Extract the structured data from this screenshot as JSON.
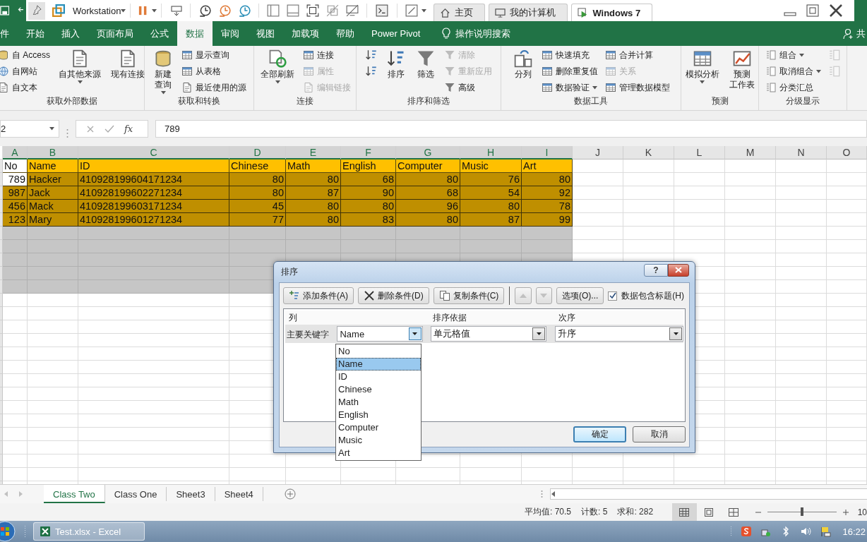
{
  "vm_toolbar": {
    "machine": "Workstation",
    "tabs": [
      {
        "kind": "home",
        "label": "主页",
        "selected": false
      },
      {
        "kind": "computer",
        "label": "我的计算机",
        "selected": false
      },
      {
        "kind": "vm",
        "label": "Windows 7",
        "selected": true
      }
    ]
  },
  "ribbon": {
    "tabs": [
      {
        "label": "件",
        "selected": false
      },
      {
        "label": "开始",
        "selected": false
      },
      {
        "label": "插入",
        "selected": false
      },
      {
        "label": "页面布局",
        "selected": false
      },
      {
        "label": "公式",
        "selected": false
      },
      {
        "label": "数据",
        "selected": true
      },
      {
        "label": "审阅",
        "selected": false
      },
      {
        "label": "视图",
        "selected": false
      },
      {
        "label": "加载项",
        "selected": false
      },
      {
        "label": "帮助",
        "selected": false
      },
      {
        "label": "Power Pivot",
        "selected": false
      }
    ],
    "tell_me": "操作说明搜索",
    "share": "共",
    "groups": [
      {
        "label": "获取外部数据",
        "items": [
          {
            "kind": "stack",
            "items": [
              {
                "kind": "small",
                "label": "自 Access",
                "disabled": false
              },
              {
                "kind": "small",
                "label": "自网站",
                "disabled": false
              },
              {
                "kind": "small",
                "label": "自文本",
                "disabled": false
              }
            ]
          },
          {
            "kind": "large",
            "label": "自其他来源",
            "disabled": false,
            "dropdown": true
          },
          {
            "kind": "large",
            "label": "现有连接",
            "disabled": false
          }
        ]
      },
      {
        "label": "获取和转换",
        "items": [
          {
            "kind": "large",
            "lines": [
              "新建",
              "查询"
            ],
            "disabled": false,
            "dropdown": true
          },
          {
            "kind": "stack",
            "items": [
              {
                "kind": "small",
                "label": "显示查询",
                "disabled": false
              },
              {
                "kind": "small",
                "label": "从表格",
                "disabled": false
              },
              {
                "kind": "small",
                "label": "最近使用的源",
                "disabled": false
              }
            ]
          }
        ]
      },
      {
        "label": "连接",
        "items": [
          {
            "kind": "large",
            "label": "全部刷新",
            "disabled": false,
            "dropdown": true
          },
          {
            "kind": "stack",
            "items": [
              {
                "kind": "small",
                "label": "连接",
                "disabled": false
              },
              {
                "kind": "small",
                "label": "属性",
                "disabled": true
              },
              {
                "kind": "small",
                "label": "编辑链接",
                "disabled": true
              }
            ]
          }
        ]
      },
      {
        "label": "排序和筛选",
        "items": [
          {
            "kind": "stack",
            "items": [
              {
                "kind": "icon",
                "disabled": false
              },
              {
                "kind": "icon",
                "disabled": false
              }
            ]
          },
          {
            "kind": "large",
            "label": "排序",
            "disabled": false
          },
          {
            "kind": "large",
            "label": "筛选",
            "disabled": false
          },
          {
            "kind": "stack",
            "items": [
              {
                "kind": "small",
                "label": "清除",
                "disabled": true
              },
              {
                "kind": "small",
                "label": "重新应用",
                "disabled": true
              },
              {
                "kind": "small",
                "label": "高级",
                "disabled": false
              }
            ]
          }
        ]
      },
      {
        "label": "数据工具",
        "items": [
          {
            "kind": "large",
            "label": "分列",
            "disabled": false
          },
          {
            "kind": "stack",
            "items": [
              {
                "kind": "small",
                "label": "快速填充",
                "disabled": false
              },
              {
                "kind": "small",
                "label": "删除重复值",
                "disabled": false
              },
              {
                "kind": "small",
                "label": "数据验证",
                "disabled": false,
                "dropdown": true
              }
            ]
          },
          {
            "kind": "stack",
            "items": [
              {
                "kind": "small",
                "label": "合并计算",
                "disabled": false
              },
              {
                "kind": "small",
                "label": "关系",
                "disabled": true
              },
              {
                "kind": "small",
                "label": "管理数据模型",
                "disabled": false
              }
            ]
          }
        ]
      },
      {
        "label": "预测",
        "items": [
          {
            "kind": "large",
            "label": "模拟分析",
            "disabled": false,
            "dropdown": true
          },
          {
            "kind": "large",
            "lines": [
              "预测",
              "工作表"
            ],
            "disabled": false
          }
        ]
      },
      {
        "label": "分级显示",
        "items": [
          {
            "kind": "stack",
            "items": [
              {
                "kind": "small",
                "label": "组合",
                "disabled": false,
                "dropdown": true
              },
              {
                "kind": "small",
                "label": "取消组合",
                "disabled": false,
                "dropdown": true
              },
              {
                "kind": "small",
                "label": "分类汇总",
                "disabled": false
              }
            ]
          },
          {
            "kind": "stack",
            "items": [
              {
                "kind": "icon",
                "disabled": true
              },
              {
                "kind": "icon",
                "disabled": true
              }
            ]
          }
        ]
      }
    ]
  },
  "formula_bar": {
    "name_box": "2",
    "function_button": "fx",
    "value": "789"
  },
  "sheet": {
    "columns": [
      {
        "label": "A",
        "selected": true
      },
      {
        "label": "B",
        "selected": true
      },
      {
        "label": "C",
        "selected": true
      },
      {
        "label": "D",
        "selected": true
      },
      {
        "label": "E",
        "selected": true
      },
      {
        "label": "F",
        "selected": true
      },
      {
        "label": "G",
        "selected": true
      },
      {
        "label": "H",
        "selected": true
      },
      {
        "label": "I",
        "selected": true
      },
      {
        "label": "J",
        "selected": false
      },
      {
        "label": "K",
        "selected": false
      },
      {
        "label": "L",
        "selected": false
      },
      {
        "label": "M",
        "selected": false
      },
      {
        "label": "N",
        "selected": false
      },
      {
        "label": "O",
        "selected": false
      }
    ],
    "rows": [
      {
        "kind": "header",
        "active": true,
        "cells": [
          "No",
          "Name",
          "ID",
          "Chinese",
          "Math",
          "English",
          "Computer",
          "Music",
          "Art"
        ]
      },
      {
        "kind": "data",
        "active": true,
        "cells": [
          "789",
          "Hacker",
          "410928199604171234",
          "80",
          "80",
          "68",
          "80",
          "76",
          "80"
        ]
      },
      {
        "kind": "data",
        "active": false,
        "cells": [
          "987",
          "Jack",
          "410928199602271234",
          "80",
          "87",
          "90",
          "68",
          "54",
          "92"
        ]
      },
      {
        "kind": "data",
        "active": false,
        "cells": [
          "456",
          "Mack",
          "410928199603171234",
          "45",
          "80",
          "80",
          "96",
          "80",
          "78"
        ]
      },
      {
        "kind": "data",
        "active": false,
        "cells": [
          "123",
          "Mary",
          "410928199601271234",
          "77",
          "80",
          "83",
          "80",
          "87",
          "99"
        ]
      },
      {
        "kind": "blank",
        "selected": true
      },
      {
        "kind": "blank",
        "selected": true
      },
      {
        "kind": "blank",
        "selected": true
      },
      {
        "kind": "blank",
        "selected": true
      },
      {
        "kind": "blank",
        "selected": true
      }
    ]
  },
  "sheet_tabs": [
    {
      "label": "Class Two",
      "selected": true
    },
    {
      "label": "Class One",
      "selected": false
    },
    {
      "label": "Sheet3",
      "selected": false
    },
    {
      "label": "Sheet4",
      "selected": false
    }
  ],
  "status_bar": {
    "average": "平均值: 70.5",
    "count": "计数: 5",
    "sum": "求和: 282",
    "views": [
      {
        "kind": "normal",
        "selected": true
      },
      {
        "kind": "page_layout",
        "selected": false
      },
      {
        "kind": "page_break",
        "selected": false
      }
    ],
    "zoom": {
      "level": 0.5,
      "label": "10"
    }
  },
  "taskbar": {
    "apps": [
      {
        "label": "Test.xlsx - Excel",
        "active": true
      }
    ],
    "clock": "16:22"
  },
  "sort_dialog": {
    "title": "排序",
    "help_button": "?",
    "toolbar": [
      {
        "kind": "add",
        "label": "添加条件(A)",
        "disabled": false
      },
      {
        "kind": "delete",
        "label": "删除条件(D)",
        "disabled": false
      },
      {
        "kind": "copy",
        "label": "复制条件(C)",
        "disabled": false
      },
      {
        "kind": "up",
        "disabled": true
      },
      {
        "kind": "down",
        "disabled": true
      },
      {
        "kind": "options",
        "label": "选项(O)...",
        "disabled": false
      }
    ],
    "has_headers": {
      "label": "数据包含标题(H)",
      "checked": true
    },
    "columns": [
      "列",
      "排序依据",
      "次序"
    ],
    "levels": [
      {
        "label": "主要关键字",
        "column": "Name",
        "sort_on": "单元格值",
        "order": "升序",
        "selected": true
      }
    ],
    "dropdown": {
      "expanded": true,
      "options": [
        {
          "label": "No",
          "selected": false
        },
        {
          "label": "Name",
          "selected": true
        },
        {
          "label": "ID",
          "selected": false
        },
        {
          "label": "Chinese",
          "selected": false
        },
        {
          "label": "Math",
          "selected": false
        },
        {
          "label": "English",
          "selected": false
        },
        {
          "label": "Computer",
          "selected": false
        },
        {
          "label": "Music",
          "selected": false
        },
        {
          "label": "Art",
          "selected": false
        }
      ]
    },
    "buttons": [
      {
        "label": "确定",
        "default": true
      },
      {
        "label": "取消",
        "default": false
      }
    ]
  }
}
